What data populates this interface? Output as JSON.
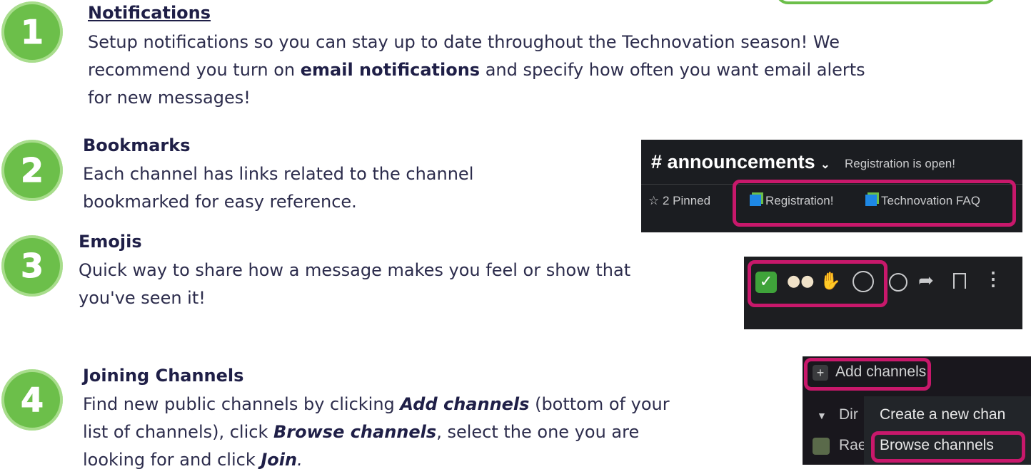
{
  "top_button": "",
  "sections": [
    {
      "number": "1",
      "heading": "Notifications",
      "lines": [
        "Setup notifications so you can stay up to date throughout the Technovation season! We",
        [
          "recommend you turn on ",
          "email notifications",
          " and specify how often you want email alerts"
        ],
        "for new messages!"
      ]
    },
    {
      "number": "2",
      "heading": "Bookmarks",
      "lines": [
        "Each channel has links related to the channel",
        "bookmarked for easy reference."
      ]
    },
    {
      "number": "3",
      "heading": "Emojis",
      "lines": [
        "Quick way to share how a message makes you feel or show that",
        "you've seen it!"
      ]
    },
    {
      "number": "4",
      "heading": "Joining Channels",
      "lines": [
        [
          "Find new public channels by clicking ",
          "Add channels",
          " (bottom of your"
        ],
        [
          "list of channels), click ",
          "Browse channels",
          ", select the one you are"
        ],
        [
          "looking for and click ",
          "Join",
          "."
        ]
      ]
    }
  ],
  "bookmark_panel": {
    "channel": "announcements",
    "topic": "Registration is open!",
    "pinned": "2 Pinned",
    "bookmarks": [
      "Registration!",
      "Technovation FAQ"
    ]
  },
  "emoji_bar": {
    "emojis": [
      "✅",
      "👀",
      "🙌"
    ]
  },
  "channels_panel": {
    "add_channels": "Add channels",
    "dir": "Dir",
    "rae": "Rae",
    "create": "Create a new chan",
    "browse": "Browse channels"
  }
}
